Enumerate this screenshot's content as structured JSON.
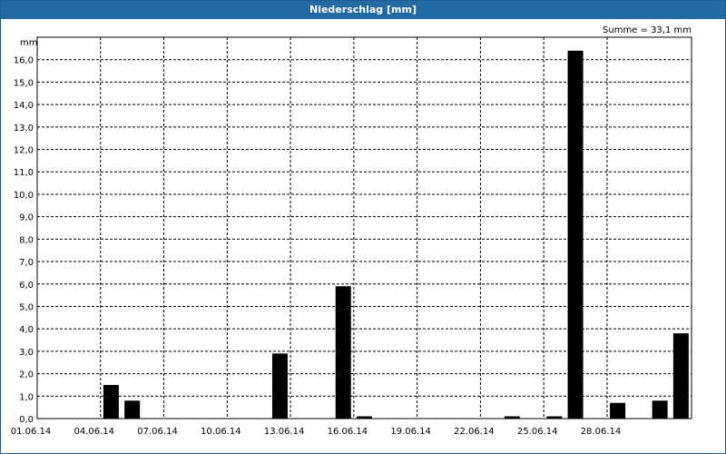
{
  "window": {
    "title": "Niederschlag [mm]"
  },
  "colors": {
    "titlebar": "#236aa3",
    "bar": "#000000",
    "grid": "#000000"
  },
  "chart_data": {
    "type": "bar",
    "title": "Niederschlag [mm]",
    "ylabel": "mm",
    "annotation": "Summe = 33,1 mm",
    "ylim": [
      0,
      17
    ],
    "grid": true,
    "y_ticks": [
      "0,0",
      "1,0",
      "2,0",
      "3,0",
      "4,0",
      "5,0",
      "6,0",
      "7,0",
      "8,0",
      "9,0",
      "10,0",
      "11,0",
      "12,0",
      "13,0",
      "14,0",
      "15,0",
      "16,0"
    ],
    "x_ticks": [
      "01.06.14",
      "04.06.14",
      "07.06.14",
      "10.06.14",
      "13.06.14",
      "16.06.14",
      "19.06.14",
      "22.06.14",
      "25.06.14",
      "28.06.14"
    ],
    "categories": [
      "01.06.14",
      "02.06.14",
      "03.06.14",
      "04.06.14",
      "05.06.14",
      "06.06.14",
      "07.06.14",
      "08.06.14",
      "09.06.14",
      "10.06.14",
      "11.06.14",
      "12.06.14",
      "13.06.14",
      "14.06.14",
      "15.06.14",
      "16.06.14",
      "17.06.14",
      "18.06.14",
      "19.06.14",
      "20.06.14",
      "21.06.14",
      "22.06.14",
      "23.06.14",
      "24.06.14",
      "25.06.14",
      "26.06.14",
      "27.06.14",
      "28.06.14",
      "29.06.14",
      "30.06.14"
    ],
    "values": [
      0,
      0,
      0,
      1.5,
      0.8,
      0,
      0,
      0,
      0,
      0,
      0,
      2.9,
      0,
      0,
      5.9,
      0.1,
      0,
      0,
      0,
      0,
      0,
      0,
      0.1,
      0,
      0.1,
      16.4,
      0,
      0.7,
      0,
      0.8,
      3.8
    ]
  }
}
